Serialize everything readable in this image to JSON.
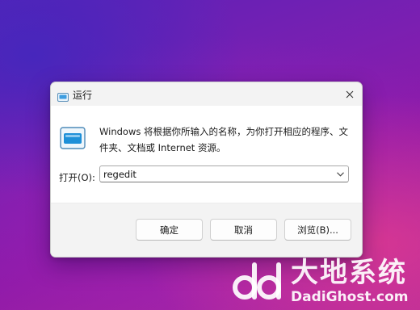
{
  "window": {
    "title": "运行",
    "app_icon": "run-icon",
    "close_icon": "close-icon"
  },
  "description": "Windows 将根据你所输入的名称，为你打开相应的程序、文件夹、文档或 Internet 资源。",
  "open": {
    "label": "打开(O):",
    "value": "regedit",
    "dropdown_icon": "chevron-down-icon"
  },
  "buttons": {
    "ok": "确定",
    "cancel": "取消",
    "browse": "浏览(B)..."
  },
  "watermark": {
    "logo": "dd-logo",
    "name_cn": "大地系统",
    "site": "DadiGhost.com"
  },
  "colors": {
    "dialog_bg": "#f3f3f3",
    "content_bg": "#ffffff",
    "wallpaper_primary": "#7b1fb1",
    "wallpaper_accent": "#ff4682",
    "icon_accent": "#1e90d8"
  }
}
